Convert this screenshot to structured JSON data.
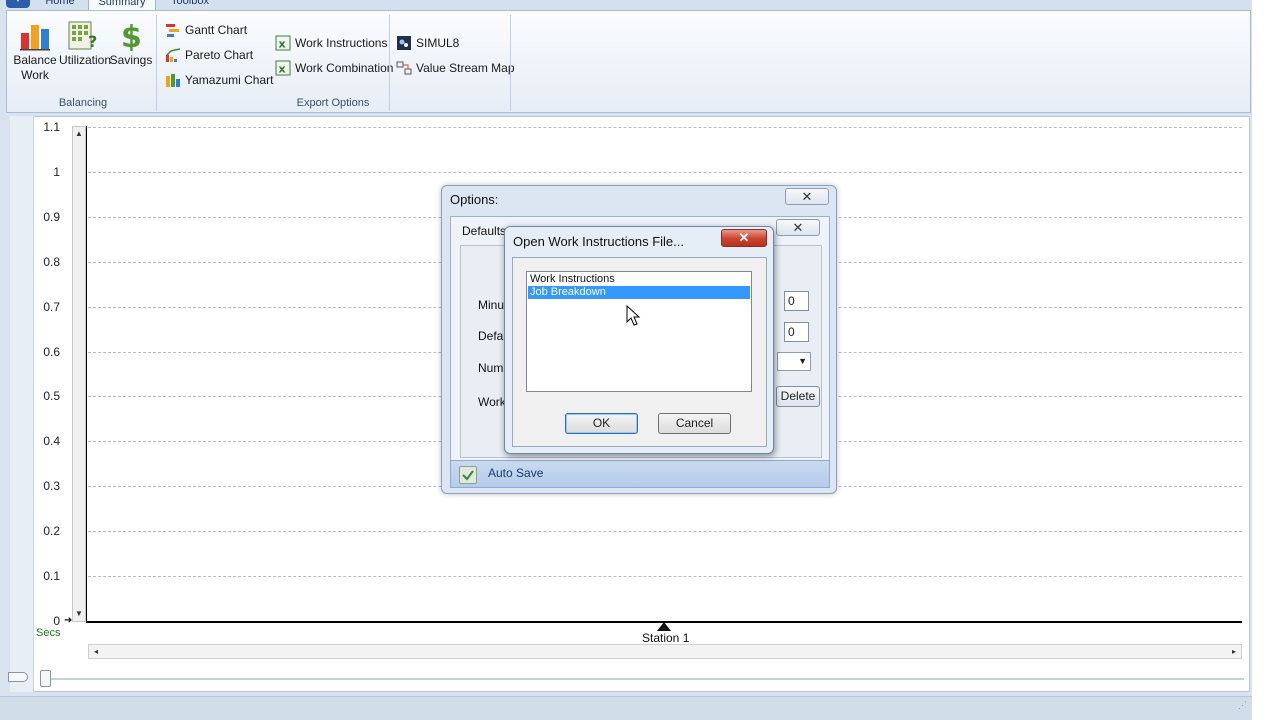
{
  "ribbon": {
    "tabs": [
      {
        "label": "Home"
      },
      {
        "label": "Summary"
      },
      {
        "label": "Toolbox"
      }
    ],
    "balancing": {
      "group_label": "Balancing",
      "balance_work": [
        "Balance",
        "Work"
      ],
      "utilization": "Utilization",
      "savings": "Savings"
    },
    "export": {
      "group_label": "Export Options",
      "gantt": "Gantt Chart",
      "pareto": "Pareto Chart",
      "yamazumi": "Yamazumi Chart",
      "work_instructions": "Work Instructions",
      "work_combination": "Work Combination",
      "simul8": "SIMUL8",
      "value_stream_map": "Value Stream Map"
    }
  },
  "chart": {
    "y_ticks": [
      "1.1",
      "1",
      "0.9",
      "0.8",
      "0.7",
      "0.6",
      "0.5",
      "0.4",
      "0.3",
      "0.2",
      "0.1",
      "0"
    ],
    "y_unit": "Secs",
    "station_label": "Station 1"
  },
  "chart_data": {
    "type": "bar",
    "categories": [
      "Station 1"
    ],
    "values": [
      0
    ],
    "ylabel": "Secs",
    "ylim": [
      0,
      1.1
    ],
    "grid": true
  },
  "options_dialog": {
    "title": "Options:",
    "close_symbol": "✕",
    "defaults": {
      "title": "Defaults",
      "close_symbol": "✕",
      "labels": [
        "Minute",
        "Defau",
        "Numbe",
        "Work"
      ],
      "field1_value": "0",
      "field2_value": "0",
      "delete_label": "Delete"
    },
    "auto_save_label": "Auto Save"
  },
  "open_dialog": {
    "title": "Open Work Instructions File...",
    "close_symbol": "✕",
    "files": [
      "Work Instructions",
      "Job Breakdown"
    ],
    "selected_index": 1,
    "ok_label": "OK",
    "cancel_label": "Cancel"
  }
}
